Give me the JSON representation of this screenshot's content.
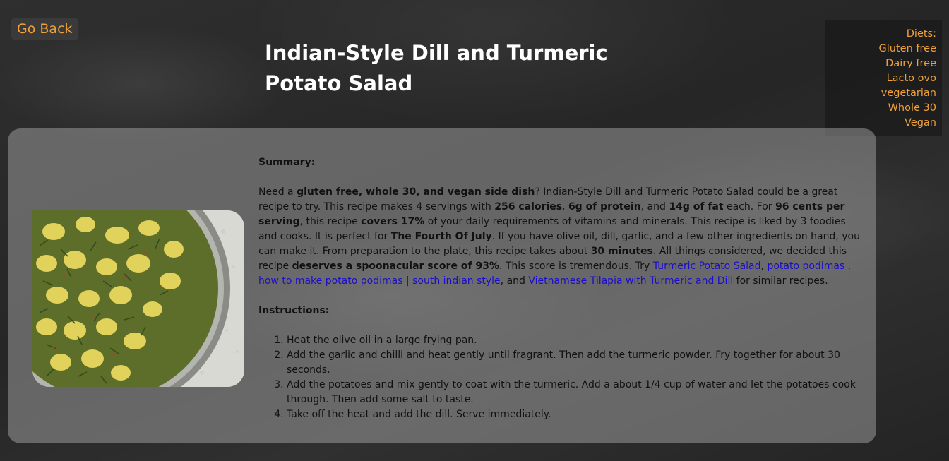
{
  "nav": {
    "go_back": "Go Back"
  },
  "recipe": {
    "title": "Indian-Style Dill and Turmeric Potato Salad",
    "image_alt": "Dill and turmeric potato salad in a metal bowl"
  },
  "diets": {
    "heading": "Diets:",
    "items": [
      "Gluten free",
      "Dairy free",
      "Lacto ovo vegetarian",
      "Whole 30",
      "Vegan"
    ]
  },
  "summary": {
    "heading": "Summary:",
    "s1": "Need a ",
    "b1": "gluten free, whole 30, and vegan side dish",
    "s2": "? Indian-Style Dill and Turmeric Potato Salad could be a great recipe to try. This recipe makes 4 servings with ",
    "b2": "256 calories",
    "s3": ", ",
    "b3": "6g of protein",
    "s4": ", and ",
    "b4": "14g of fat",
    "s5": " each. For ",
    "b5": "96 cents per serving",
    "s6": ", this recipe ",
    "b6": "covers 17%",
    "s7": " of your daily requirements of vitamins and minerals. This recipe is liked by 3 foodies and cooks. It is perfect for ",
    "b7": "The Fourth Of July",
    "s8": ". If you have olive oil, dill, garlic, and a few other ingredients on hand, you can make it. From preparation to the plate, this recipe takes about ",
    "b8": "30 minutes",
    "s9": ". All things considered, we decided this recipe ",
    "b9": "deserves a spoonacular score of 93%",
    "s10": ". This score is tremendous. Try ",
    "link1": "Turmeric Potato Salad",
    "s11": ", ",
    "link2": "potato podimas , how to make potato podimas | south indian style",
    "s12": ", and ",
    "link3": "Vietnamese Tilapia with Turmeric and Dill",
    "s13": " for similar recipes."
  },
  "instructions": {
    "heading": "Instructions:",
    "steps": [
      "Heat the olive oil in a large frying pan.",
      "Add the garlic and chilli and heat gently until fragrant. Then add the turmeric powder. Fry together for about 30 seconds.",
      "Add the potatoes and mix gently to coat with the turmeric. Add a about 1/4 cup of water and let the potatoes cook through. Then add some salt to taste.",
      "Take off the heat and add the dill. Serve immediately."
    ]
  },
  "colors": {
    "accent": "#f0a13a",
    "link": "#1a0dcc",
    "card": "rgba(160,160,160,0.52)"
  }
}
